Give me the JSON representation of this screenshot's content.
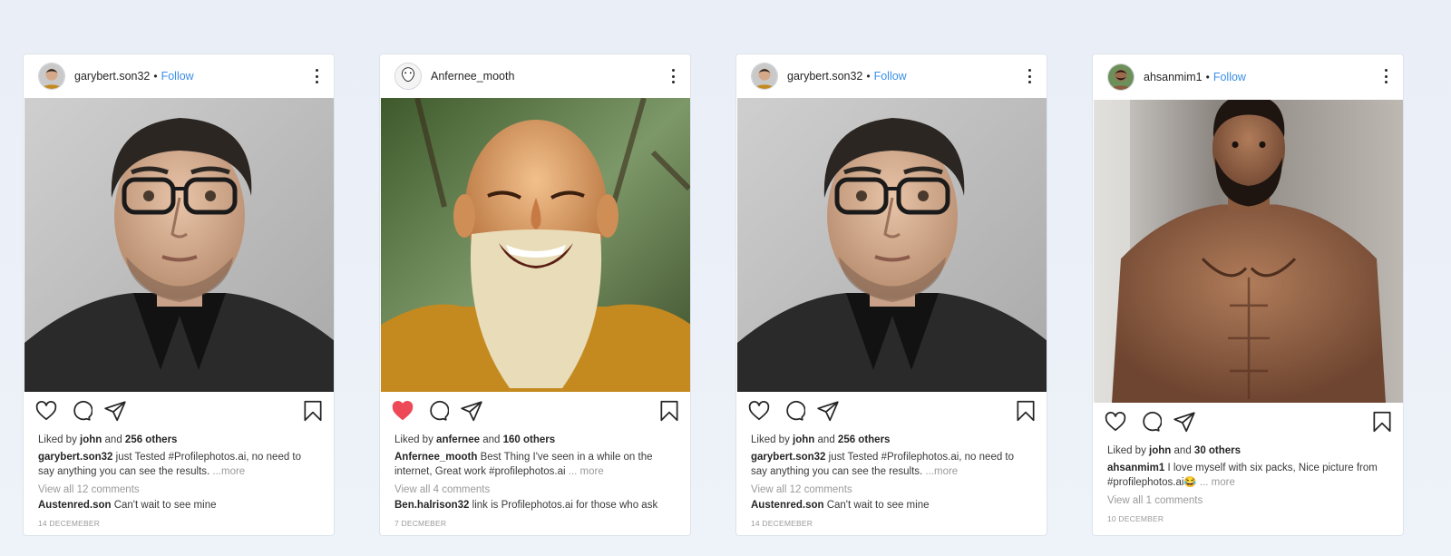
{
  "posts": [
    {
      "username": "garybert.son32",
      "follow_label": "Follow",
      "show_follow": true,
      "liked": false,
      "likes_prefix": "Liked by",
      "liked_by": "john",
      "likes_and": "and",
      "likes_others": "256 others",
      "caption_user": "garybert.son32",
      "caption_text": " just Tested #Profilephotos.ai, no need to say anything you can see the results. ",
      "more_label": " ...more",
      "view_comments": "View all 12 comments",
      "comment_user": "Austenred.son",
      "comment_text": " Can't wait to see mine",
      "date": "14 DECEMEBER",
      "photo": "young man with glasses, black jacket"
    },
    {
      "username": "Anfernee_mooth",
      "follow_label": "",
      "show_follow": false,
      "liked": true,
      "likes_prefix": "Liked by",
      "liked_by": "anfernee",
      "likes_and": "and",
      "likes_others": "160 others",
      "caption_user": "Anfernee_mooth",
      "caption_text": " Best Thing I've seen in a while on the internet, Great work #profilephotos.ai ",
      "more_label": "... more",
      "view_comments": "View all 4 comments",
      "comment_user": "Ben.halrison32",
      "comment_text": " link is Profilephotos.ai for those who ask",
      "date": "7 DECMEBER",
      "photo": "laughing bald man with white beard, forest background"
    },
    {
      "username": "garybert.son32",
      "follow_label": "Follow",
      "show_follow": true,
      "liked": false,
      "likes_prefix": "Liked by",
      "liked_by": "john",
      "likes_and": "and",
      "likes_others": "256 others",
      "caption_user": "garybert.son32",
      "caption_text": " just Tested #Profilephotos.ai, no need to say anything you can see the results. ",
      "more_label": " ...more",
      "view_comments": "View all 12 comments",
      "comment_user": "Austenred.son",
      "comment_text": " Can't wait to see mine",
      "date": "14 DECEMEBER",
      "photo": "young man with glasses, black jacket"
    },
    {
      "username": "ahsanmim1",
      "follow_label": "Follow",
      "show_follow": true,
      "liked": false,
      "likes_prefix": "Liked by",
      "liked_by": "john",
      "likes_and": "and",
      "likes_others": "30 others",
      "caption_user": "ahsanmim1",
      "caption_text": " I love myself with six packs, Nice picture from #profilephotos.ai😂 ",
      "more_label": "... more",
      "view_comments": "View all 1 comments",
      "comment_user": "",
      "comment_text": "",
      "date": "10 DECEMBER",
      "photo": "shirtless bearded man"
    }
  ],
  "icons": [
    "heart-icon",
    "comment-icon",
    "share-icon",
    "bookmark-icon",
    "more-options-icon"
  ],
  "colors": {
    "accent": "#3b8ee8",
    "liked": "#ed4956",
    "text": "#262626",
    "muted": "#9a9a9a"
  }
}
